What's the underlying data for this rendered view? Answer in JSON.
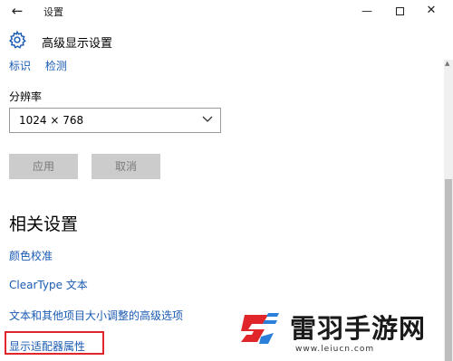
{
  "window": {
    "title": "设置",
    "back_glyph": "←",
    "minimize_glyph": "—",
    "close_glyph": "✕"
  },
  "header": {
    "title": "高级显示设置",
    "icon": "gear-icon"
  },
  "top_links": [
    "标识",
    "检测"
  ],
  "resolution": {
    "label": "分辨率",
    "selected": "1024 × 768"
  },
  "buttons": {
    "apply": "应用",
    "cancel": "取消"
  },
  "related": {
    "title": "相关设置",
    "links": [
      "颜色校准",
      "ClearType 文本",
      "文本和其他项目大小调整的高级选项",
      "显示适配器属性"
    ]
  },
  "watermark": {
    "name": "雷羽手游网",
    "url": "www.leiucn.com"
  },
  "colors": {
    "link": "#1a5bb3",
    "highlight_box": "#e0262a",
    "button_disabled_bg": "#cccccc",
    "logo_red": "#e0262a",
    "logo_blue": "#2b7fd8"
  }
}
